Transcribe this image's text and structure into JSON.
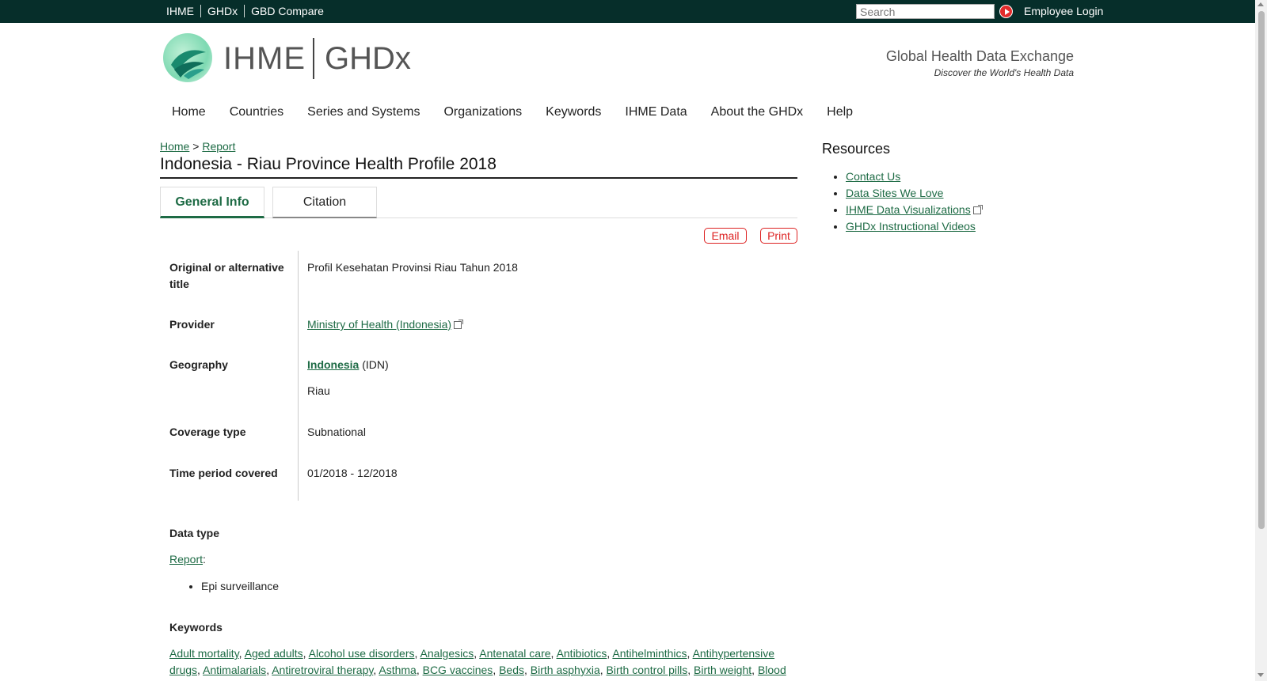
{
  "topbar": {
    "links": [
      "IHME",
      "GHDx",
      "GBD Compare"
    ],
    "search_placeholder": "Search",
    "employee_login": "Employee Login"
  },
  "header": {
    "logo_ihme": "IHME",
    "logo_ghdx": "GHDx",
    "tagline": "Global Health Data Exchange",
    "subtagline": "Discover the World's Health Data"
  },
  "nav": [
    "Home",
    "Countries",
    "Series and Systems",
    "Organizations",
    "Keywords",
    "IHME Data",
    "About the GHDx",
    "Help"
  ],
  "breadcrumb": {
    "home": "Home",
    "sep": ">",
    "report": "Report"
  },
  "page_title": "Indonesia - Riau Province Health Profile 2018",
  "tabs": {
    "general": "General Info",
    "citation": "Citation"
  },
  "actions": {
    "email": "Email",
    "print": "Print"
  },
  "fields": {
    "alt_title_label": "Original or alternative title",
    "alt_title_value": "Profil Kesehatan Provinsi Riau Tahun 2018",
    "provider_label": "Provider",
    "provider_value": "Ministry of Health (Indonesia)",
    "geography_label": "Geography",
    "geography_country": "Indonesia",
    "geography_code": "(IDN)",
    "geography_region": "Riau",
    "coverage_label": "Coverage type",
    "coverage_value": "Subnational",
    "time_label": "Time period covered",
    "time_value": "01/2018 - 12/2018"
  },
  "data_type": {
    "label": "Data type",
    "link": "Report",
    "items": [
      "Epi surveillance"
    ]
  },
  "keywords": {
    "label": "Keywords",
    "items": [
      "Adult mortality",
      "Aged adults",
      "Alcohol use disorders",
      "Analgesics",
      "Antenatal care",
      "Antibiotics",
      "Antihelminthics",
      "Antihypertensive drugs",
      "Antimalarials",
      "Antiretroviral therapy",
      "Asthma",
      "BCG vaccines",
      "Beds",
      "Birth asphyxia",
      "Birth control pills",
      "Birth weight",
      "Blood"
    ]
  },
  "resources": {
    "title": "Resources",
    "items": [
      "Contact Us",
      "Data Sites We Love",
      "IHME Data Visualizations",
      "GHDx Instructional Videos"
    ]
  }
}
